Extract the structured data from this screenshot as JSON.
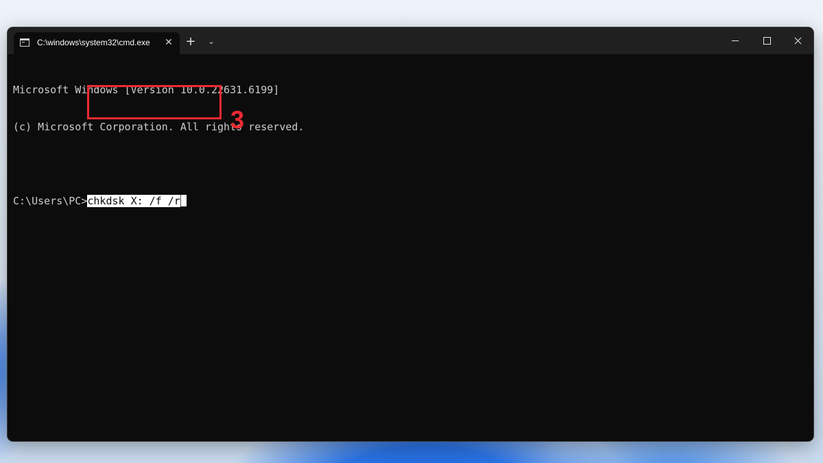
{
  "window": {
    "tab_title": "C:\\windows\\system32\\cmd.exe",
    "tab_close_glyph": "✕",
    "new_tab_glyph": "+",
    "dropdown_glyph": "⌄"
  },
  "terminal": {
    "lines": [
      "Microsoft Windows [Version 10.0.22631.6199]",
      "(c) Microsoft Corporation. All rights reserved."
    ],
    "prompt": "C:\\Users\\PC>",
    "command": "chkdsk X: /f /r"
  },
  "annotation": {
    "step_number": "3",
    "color": "#ef2a33"
  },
  "icons": {
    "tab_icon": "terminal-icon",
    "close_tab": "close-icon",
    "new_tab": "plus-icon",
    "dropdown": "chevron-down-icon",
    "minimize": "minimize-icon",
    "maximize": "maximize-icon",
    "close_window": "close-icon"
  },
  "colors": {
    "terminal_bg": "#0c0c0c",
    "titlebar_bg": "#202020",
    "terminal_text": "#cccccc",
    "highlight": "#ef2a33"
  }
}
